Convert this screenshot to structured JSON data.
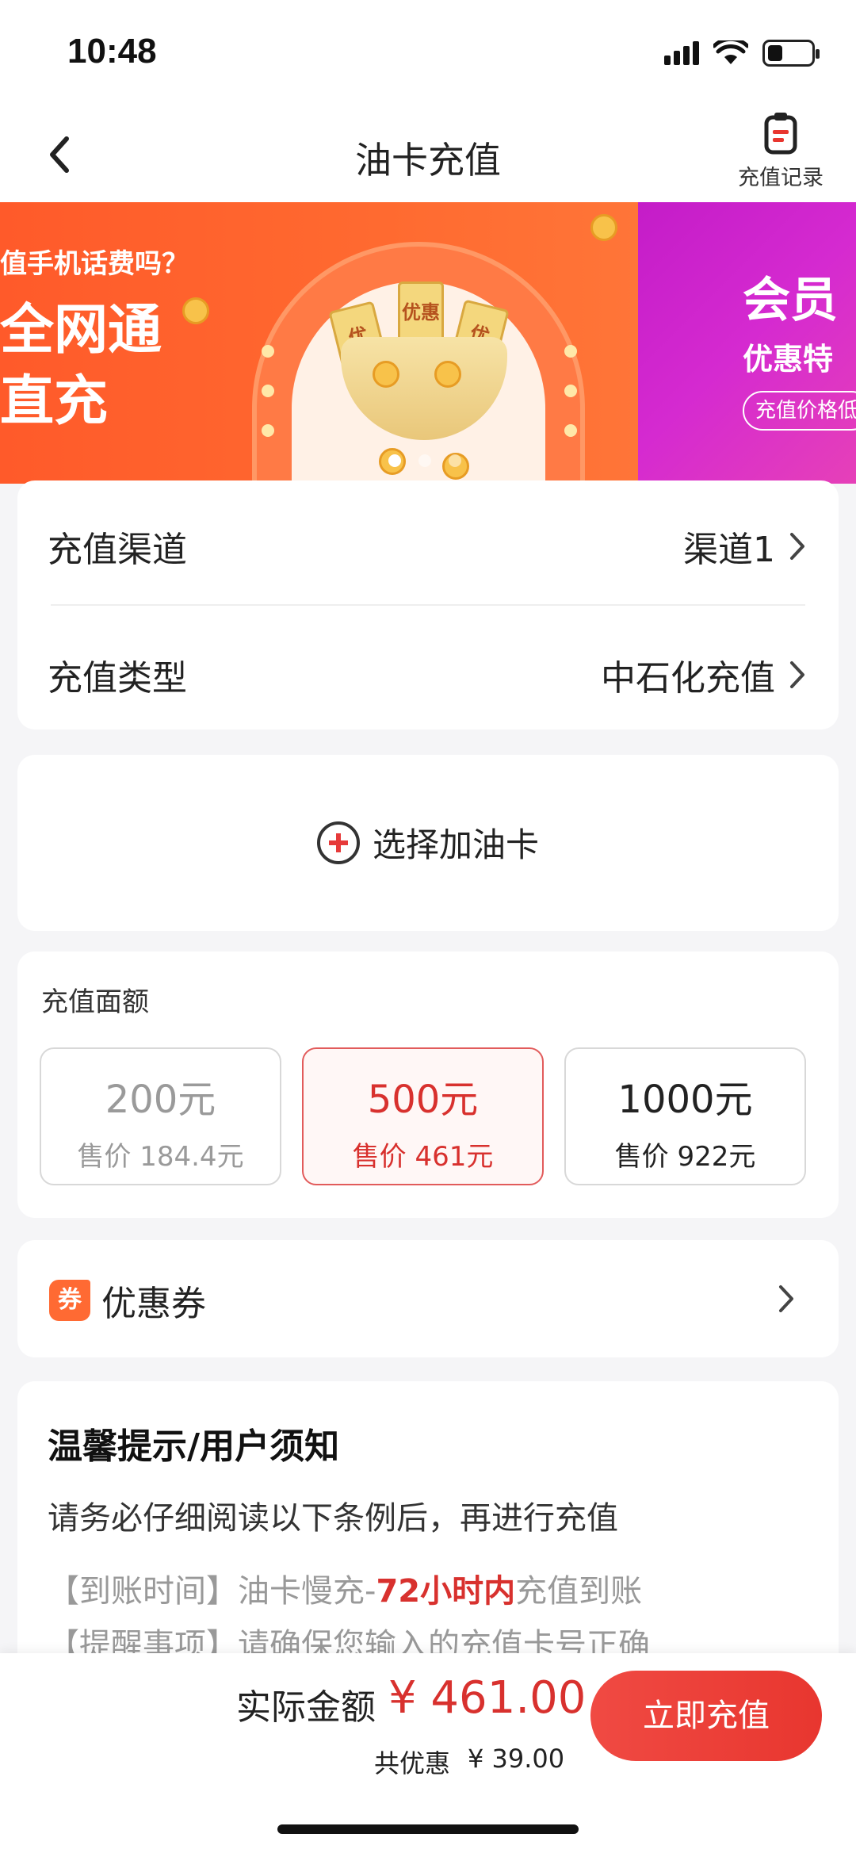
{
  "status_bar": {
    "time": "10:48",
    "signal_icon": "signal-bars-icon",
    "wifi_icon": "wifi-icon",
    "battery_icon": "battery-icon",
    "battery_level": 0.35
  },
  "nav": {
    "title": "油卡充值",
    "back_icon": "chevron-left-icon",
    "record_icon": "clipboard-icon",
    "record_label": "充值记录"
  },
  "banner": {
    "slides": [
      {
        "line1": "值手机话费吗？",
        "line2": "全网通",
        "line3": "直充",
        "tickets": [
          "优",
          "优惠",
          "优"
        ]
      },
      {
        "line1": "会员",
        "line2": "优惠特",
        "tag": "充值价格低"
      }
    ],
    "active_dot": 0,
    "dot_count": 3
  },
  "channel": {
    "channel_label": "充值渠道",
    "channel_value": "渠道1",
    "type_label": "充值类型",
    "type_value": "中石化充值"
  },
  "oil_card": {
    "add_label": "选择加油卡",
    "add_icon": "plus-circle-icon"
  },
  "amounts": {
    "title": "充值面额",
    "options": [
      {
        "face": "200元",
        "price": "售价 184.4元",
        "state": "disabled"
      },
      {
        "face": "500元",
        "price": "售价 461元",
        "state": "selected"
      },
      {
        "face": "1000元",
        "price": "售价 922元",
        "state": "normal"
      }
    ]
  },
  "coupon": {
    "icon_text": "券",
    "label": "优惠券"
  },
  "notice": {
    "title": "温馨提示/用户须知",
    "subtitle": "请务必仔细阅读以下条例后，再进行充值",
    "line1_prefix": "【到账时间】油卡慢充-",
    "line1_highlight": "72小时内",
    "line1_suffix": "充值到账",
    "line2": "【提醒事项】请确保您输入的充值卡号正确"
  },
  "footer": {
    "total_label": "实际金额",
    "total_value": "¥ 461.00",
    "save_label": "共优惠",
    "save_value": "¥ 39.00",
    "pay_label": "立即充值"
  },
  "colors": {
    "accent_red": "#e8362f",
    "banner_orange": "#ff5a2a",
    "banner_purple": "#c41cc8"
  }
}
